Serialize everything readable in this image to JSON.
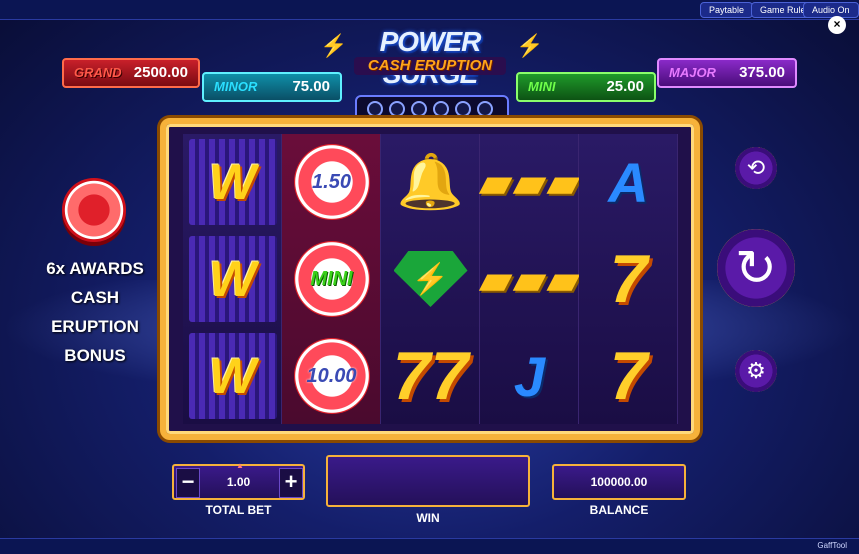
{
  "topbar": {
    "paytable": "Paytable",
    "game_rules": "Game Rules",
    "audio": "Audio On",
    "close": "×"
  },
  "title": {
    "line1": "POWER SURGE",
    "line2": "CASH ERUPTION"
  },
  "jackpots": {
    "grand": {
      "label": "GRAND",
      "value": "2500.00"
    },
    "minor": {
      "label": "MINOR",
      "value": "75.00"
    },
    "mini": {
      "label": "MINI",
      "value": "25.00"
    },
    "major": {
      "label": "MAJOR",
      "value": "375.00"
    }
  },
  "bonus": {
    "line1": "6x AWARDS",
    "line2": "CASH ERUPTION",
    "line3": "BONUS"
  },
  "reels": {
    "r1": [
      "W",
      "W",
      "W"
    ],
    "r2": [
      "1.50",
      "MINI",
      "10.00"
    ],
    "r4": [
      "gold-bars",
      "gold-bars",
      "J"
    ],
    "r5": [
      "A",
      "7",
      "7"
    ]
  },
  "controls": {
    "bet_minus": "−",
    "bet_plus": "+",
    "bet_value": "1.00",
    "balance": "100000.00"
  },
  "labels": {
    "total_bet": "TOTAL BET",
    "win": "WIN",
    "balance": "BALANCE"
  },
  "footer": {
    "gafftool": "GaffTool"
  },
  "colors": {
    "frame": "#f6b23a",
    "background": "#141e6a",
    "grand": "#c8202a",
    "minor": "#0f8fa8",
    "mini": "#1f9a2a",
    "major": "#8a2ac8"
  }
}
